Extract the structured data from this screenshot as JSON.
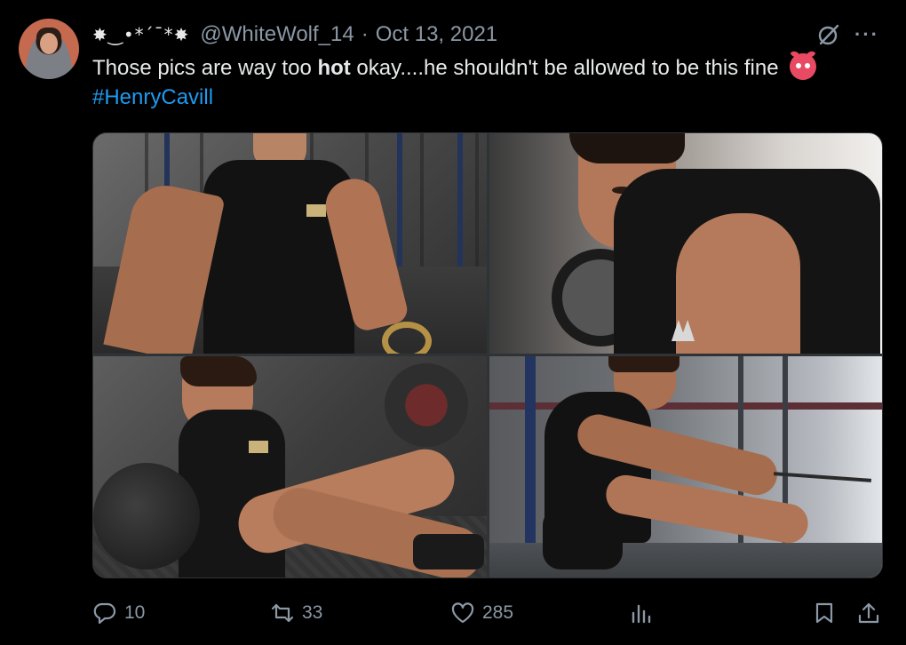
{
  "author": {
    "display_name": "✸‿•*´¯*✸",
    "handle": "@WhiteWolf_14",
    "separator": "·",
    "date": "Oct 13, 2021"
  },
  "tweet": {
    "text_before": "Those pics are way too ",
    "text_bold": "hot",
    "text_after": " okay....he shouldn't be allowed to be this fine",
    "emoji": "hot-face-devil-emoji",
    "hashtag": "#HenryCavill"
  },
  "icons": {
    "grok": "grok-icon",
    "more": "more-icon",
    "reply": "reply-icon",
    "retweet": "retweet-icon",
    "like": "heart-icon",
    "views": "views-icon",
    "bookmark": "bookmark-icon",
    "share": "share-icon"
  },
  "actions": {
    "replies": "10",
    "retweets": "33",
    "likes": "285"
  },
  "colors": {
    "background": "#000000",
    "text": "#e7e9ea",
    "muted": "#8b98a5",
    "link": "#1d9bf0"
  }
}
